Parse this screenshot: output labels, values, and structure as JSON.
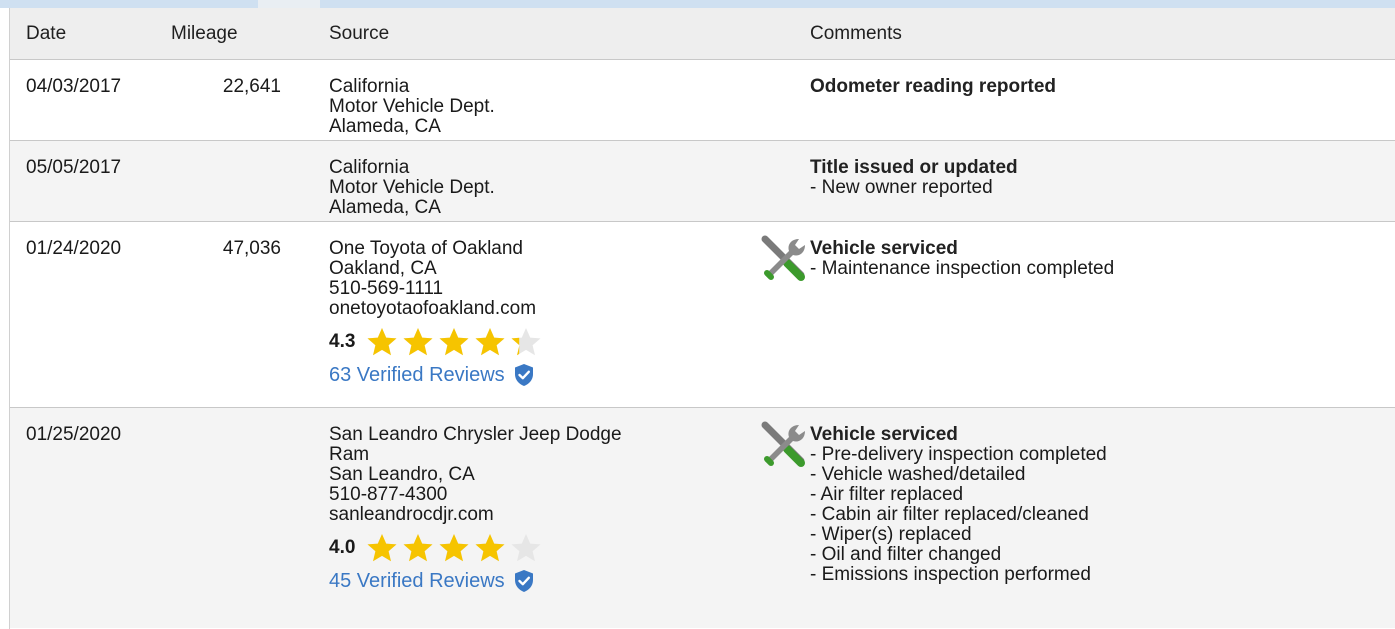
{
  "header": {
    "date": "Date",
    "mileage": "Mileage",
    "source": "Source",
    "comments": "Comments"
  },
  "colors": {
    "header_bg": "#eeeeee",
    "alt_row_bg": "#f4f4f4",
    "link": "#3a78c4",
    "star": "#f6c400",
    "star_empty": "#e6e6e6",
    "shield": "#3a78c4"
  },
  "rows": [
    {
      "date": "04/03/2017",
      "mileage": "22,641",
      "source": [
        "California",
        "Motor Vehicle Dept.",
        "Alameda, CA"
      ],
      "comment_title": "Odometer reading reported",
      "comment_lines": []
    },
    {
      "date": "05/05/2017",
      "mileage": "",
      "source": [
        "California",
        "Motor Vehicle Dept.",
        "Alameda, CA"
      ],
      "comment_title": "Title issued or updated",
      "comment_lines": [
        "- New owner reported"
      ]
    },
    {
      "date": "01/24/2020",
      "mileage": "47,036",
      "source": [
        "One Toyota of Oakland",
        "Oakland, CA",
        "510-569-1111",
        "onetoyotaofoakland.com"
      ],
      "rating": "4.3",
      "rating_value": 4.3,
      "reviews": "63 Verified Reviews",
      "icon": "service-wrench-icon",
      "comment_title": "Vehicle serviced",
      "comment_lines": [
        "- Maintenance inspection completed"
      ]
    },
    {
      "date": "01/25/2020",
      "mileage": "",
      "source": [
        "San Leandro Chrysler Jeep Dodge",
        "Ram",
        "San Leandro, CA",
        "510-877-4300",
        "sanleandrocdjr.com"
      ],
      "rating": "4.0",
      "rating_value": 4.0,
      "reviews": "45 Verified Reviews",
      "icon": "service-wrench-icon",
      "comment_title": "Vehicle serviced",
      "comment_lines": [
        "- Pre-delivery inspection completed",
        "- Vehicle washed/detailed",
        "- Air filter replaced",
        "- Cabin air filter replaced/cleaned",
        "- Wiper(s) replaced",
        "- Oil and filter changed",
        "- Emissions inspection performed"
      ]
    }
  ]
}
